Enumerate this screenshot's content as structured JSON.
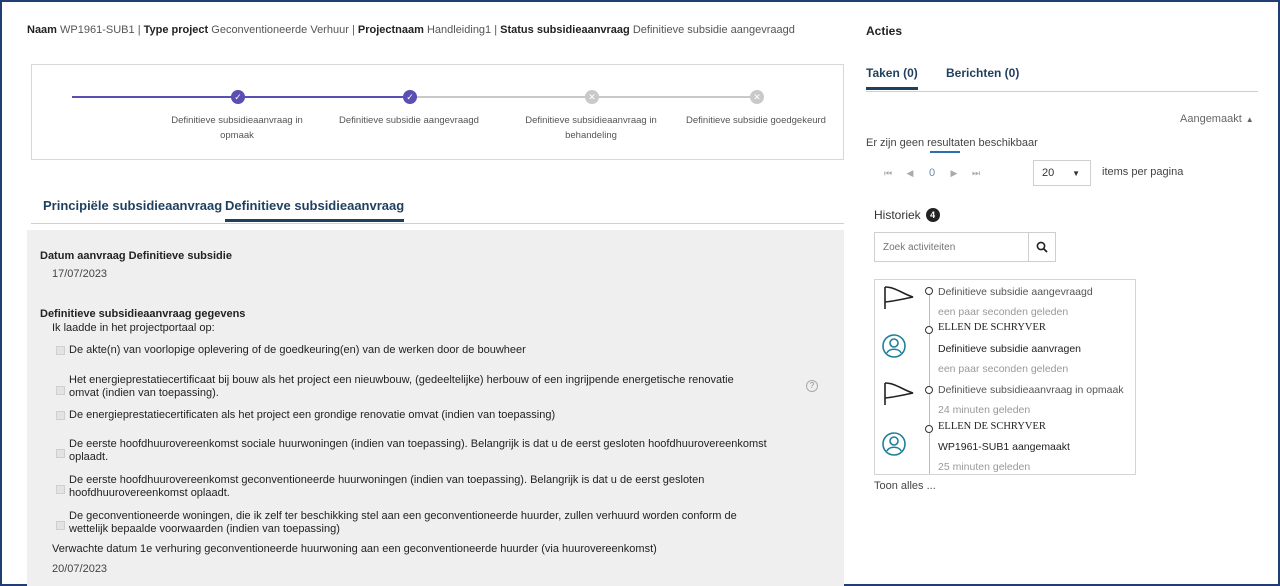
{
  "header": {
    "naam_label": "Naam",
    "naam_value": "WP1961-SUB1",
    "type_label": "Type project",
    "type_value": "Geconventioneerde Verhuur",
    "projectnaam_label": "Projectnaam",
    "projectnaam_value": "Handleiding1",
    "status_label": "Status subsidieaanvraag",
    "status_value": "Definitieve subsidie aangevraagd",
    "separator": "|"
  },
  "progress": {
    "steps": [
      {
        "line1": "Definitieve subsidieaanvraag in",
        "line2": "opmaak",
        "state": "done"
      },
      {
        "line1": "Definitieve subsidie aangevraagd",
        "line2": "",
        "state": "done"
      },
      {
        "line1": "Definitieve subsidieaanvraag in",
        "line2": "behandeling",
        "state": "todo"
      },
      {
        "line1": "Definitieve subsidie goedgekeurd",
        "line2": "",
        "state": "todo"
      }
    ],
    "done_color": "#5a4fb3",
    "todo_color": "#c9c9c9"
  },
  "tabs": {
    "principle": "Principiële subsidieaanvraag",
    "definitive": "Definitieve subsidieaanvraag"
  },
  "form": {
    "datum_label": "Datum aanvraag Definitieve subsidie",
    "datum_value": "17/07/2023",
    "gegevens_label": "Definitieve subsidieaanvraag gegevens",
    "intro": "Ik laadde in het projectportaal op:",
    "items": [
      {
        "line1": "De akte(n) van voorlopige oplevering of de goedkeuring(en) van de werken door de bouwheer",
        "line2": ""
      },
      {
        "line1": "Het energieprestatiecertificaat bij bouw als het project een nieuwbouw, (gedeeltelijke) herbouw of een ingrijpende energetische renovatie",
        "line2": "omvat (indien van toepassing)."
      },
      {
        "line1": "De energieprestatiecertificaten als het project een grondige renovatie omvat (indien van toepassing)",
        "line2": ""
      },
      {
        "line1": "De eerste hoofdhuurovereenkomst sociale huurwoningen (indien van toepassing). Belangrijk is dat u de eerst gesloten hoofdhuurovereenkomst",
        "line2": "oplaadt."
      },
      {
        "line1": "De eerste hoofdhuurovereenkomst geconventioneerde huurwoningen (indien van toepassing). Belangrijk is dat u de eerst gesloten",
        "line2": "hoofdhuurovereenkomst oplaadt."
      },
      {
        "line1": "De geconventioneerde woningen, die ik zelf ter beschikking stel aan een geconventioneerde huurder, zullen verhuurd worden conform de",
        "line2": "wettelijk bepaalde voorwaarden (indien van toepassing)"
      }
    ],
    "verwachte_label": "Verwachte datum 1e verhuring geconventioneerde huurwoning aan een geconventioneerde huurder (via huurovereenkomst)",
    "verwachte_value": "20/07/2023",
    "help_icon": "help-icon"
  },
  "actions": {
    "title": "Acties",
    "tab_taken": "Taken (0)",
    "tab_berichten": "Berichten (0)",
    "sort_label": "Aangemaakt",
    "sort_arrow": "▲",
    "no_results": "Er zijn geen resultaten beschikbaar",
    "pager": {
      "first": "⏮",
      "prev": "◀",
      "page": "0",
      "next": "▶",
      "last": "⏭"
    },
    "page_size": "20",
    "items_per_page": "items per pagina",
    "historiek_label": "Historiek",
    "historiek_count": "4",
    "search_placeholder": "Zoek activiteiten",
    "timeline": [
      {
        "icon": "flag-icon",
        "title": "Definitieve subsidie aangevraagd",
        "time": "een paar seconden geleden"
      },
      {
        "icon": "user-icon",
        "name": "ELLEN DE SCHRYVER",
        "title": "Definitieve subsidie aanvragen",
        "time": "een paar seconden geleden"
      },
      {
        "icon": "flag-icon",
        "title": "Definitieve subsidieaanvraag in opmaak",
        "time": "24 minuten geleden"
      },
      {
        "icon": "user-icon",
        "name": "ELLEN DE SCHRYVER",
        "title": "WP1961-SUB1 aangemaakt",
        "time": "25 minuten geleden"
      }
    ],
    "toon_alles": "Toon alles ..."
  }
}
